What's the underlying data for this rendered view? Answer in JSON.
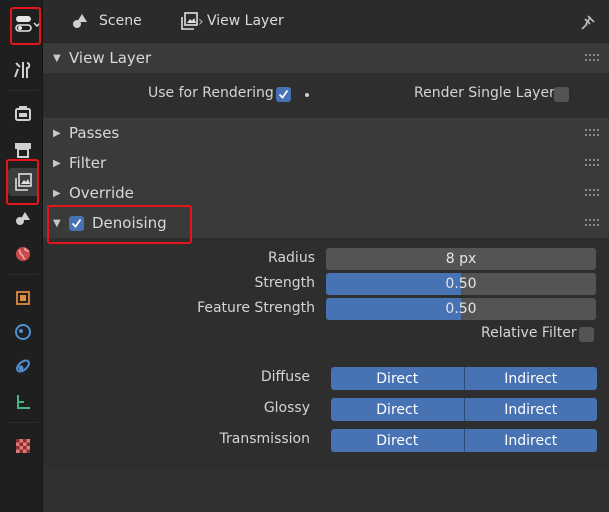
{
  "header": {
    "scene_label": "Scene",
    "view_layer_label": "View Layer"
  },
  "view_layer_panel": {
    "title": "View Layer",
    "use_for_rendering_label": "Use for Rendering",
    "use_for_rendering_checked": true,
    "render_single_layer_label": "Render Single Layer",
    "render_single_layer_checked": false
  },
  "collapsed_panels": [
    {
      "title": "Passes"
    },
    {
      "title": "Filter"
    },
    {
      "title": "Override"
    }
  ],
  "denoising": {
    "title": "Denoising",
    "enabled": true,
    "radius_label": "Radius",
    "radius_value": "8 px",
    "strength_label": "Strength",
    "strength_value": "0.50",
    "strength_fraction": 0.5,
    "feature_strength_label": "Feature Strength",
    "feature_strength_value": "0.50",
    "feature_strength_fraction": 0.5,
    "relative_filter_label": "Relative Filter",
    "relative_filter_checked": false,
    "passes": [
      {
        "label": "Diffuse",
        "direct": "Direct",
        "indirect": "Indirect"
      },
      {
        "label": "Glossy",
        "direct": "Direct",
        "indirect": "Indirect"
      },
      {
        "label": "Transmission",
        "direct": "Direct",
        "indirect": "Indirect"
      }
    ]
  },
  "colors": {
    "accent_blue": "#4772b3",
    "highlight_red": "#e3161b",
    "panel_bg": "#303030"
  },
  "icons": {
    "editor_type": "editor-type-icon",
    "tabs": [
      "tool-icon",
      "render-icon",
      "output-icon",
      "view-layer-icon",
      "scene-icon",
      "world-icon",
      "object-icon",
      "modifier-icon",
      "particles-icon",
      "physics-icon",
      "constraints-icon",
      "texture-icon"
    ]
  }
}
